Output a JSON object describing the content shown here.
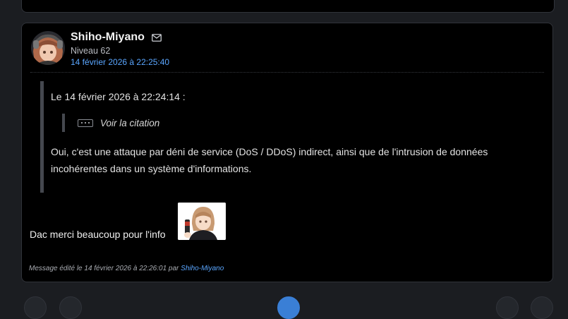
{
  "post": {
    "author": "Shiho-Miyano",
    "level": "Niveau 62",
    "date": "14 février 2026 à 22:25:40",
    "quote": {
      "header": "Le 14 février 2026 à 22:24:14 :",
      "view_quote_label": "Voir la citation",
      "body": "Oui, c'est une attaque par déni de service (DoS / DDoS) indirect, ainsi que de l'intrusion de données incohérentes dans un système d'informations."
    },
    "message": "Dac merci beaucoup pour l'info",
    "edited": {
      "prefix": "Message édité le 14 février 2026 à 22:26:01 par",
      "author": "Shiho-Miyano"
    }
  },
  "colors": {
    "page_bg": "#1b1d21",
    "card_bg": "#000000",
    "link": "#5aa6ff",
    "quote_border": "#45484f"
  },
  "icons": [
    "mail-icon",
    "more-dots-icon"
  ]
}
